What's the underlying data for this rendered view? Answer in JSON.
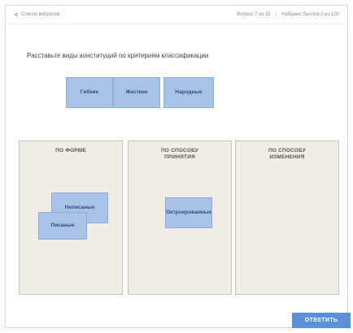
{
  "header": {
    "back_label": "Список вопросов",
    "progress_text": "Вопрос 7 из 15",
    "score_text": "Набрано баллов 0 из 100"
  },
  "question": {
    "text": "Расставьте виды конституций по критериям классификации"
  },
  "options": [
    {
      "label": "Гибкие"
    },
    {
      "label": "Жесткие"
    },
    {
      "label": "Народные"
    }
  ],
  "zones": [
    {
      "title": "ПО ФОРМЕ"
    },
    {
      "title": "ПО СПОСОБУ ПРИНЯТИЯ"
    },
    {
      "title": "ПО СПОСОБУ ИЗМЕНЕНИЯ"
    }
  ],
  "placed": [
    {
      "label": "Неписаные"
    },
    {
      "label": "Писаные"
    },
    {
      "label": "Октроированные"
    }
  ],
  "submit_label": "ОТВЕТИТЬ"
}
